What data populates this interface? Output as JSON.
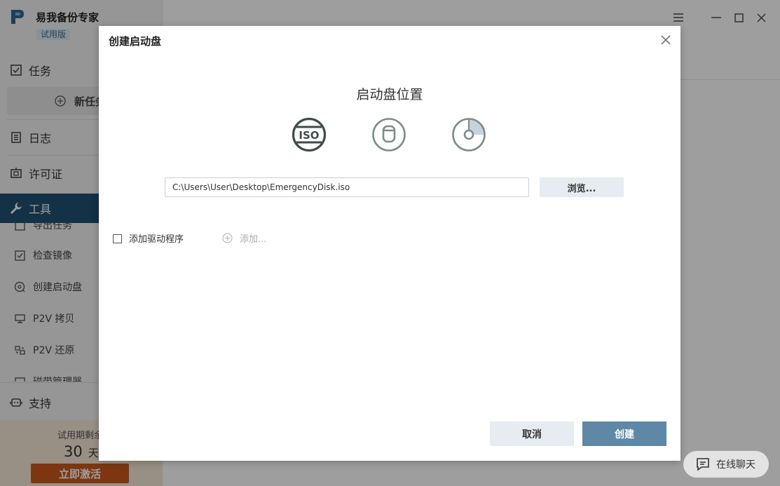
{
  "app": {
    "name": "易我备份专家",
    "badge": "试用版"
  },
  "sidebar": {
    "items": [
      {
        "label": "任务",
        "icon": "task-check-icon"
      },
      {
        "label": "日志",
        "icon": "log-icon"
      },
      {
        "label": "许可证",
        "icon": "license-icon"
      },
      {
        "label": "工具",
        "icon": "wrench-icon"
      },
      {
        "label": "支持",
        "icon": "support-icon"
      }
    ],
    "new_task_label": "新任务",
    "tools_sub": [
      {
        "label": "导出任务",
        "icon": "export-icon"
      },
      {
        "label": "检查镜像",
        "icon": "check-image-icon"
      },
      {
        "label": "创建启动盘",
        "icon": "boot-disk-icon"
      },
      {
        "label": "P2V 拷贝",
        "icon": "p2v-copy-icon"
      },
      {
        "label": "P2V 还原",
        "icon": "p2v-restore-icon"
      },
      {
        "label": "磁带管理器",
        "icon": "tape-manager-icon"
      }
    ],
    "trial": {
      "text": "试用期剩余",
      "days": "30",
      "unit": "天",
      "activate_label": "立即激活"
    }
  },
  "chat": {
    "label": "在线聊天"
  },
  "dialog": {
    "title": "创建启动盘",
    "section_title": "启动盘位置",
    "targets": [
      {
        "name": "ISO",
        "icon": "iso-icon",
        "selected": true
      },
      {
        "name": "USB",
        "icon": "usb-icon",
        "selected": false
      },
      {
        "name": "CD/DVD",
        "icon": "cd-dvd-icon",
        "selected": false
      }
    ],
    "iso_text": "ISO",
    "path_value": "C:\\Users\\User\\Desktop\\EmergencyDisk.iso",
    "browse_label": "浏览...",
    "add_driver_label": "添加驱动程序",
    "add_driver_checked": false,
    "add_label": "添加...",
    "cancel_label": "取消",
    "create_label": "创建"
  },
  "colors": {
    "sidebar_active": "#1f4f73",
    "activate": "#c85a1e",
    "primary_button": "#5e88a6",
    "secondary_button": "#e6ecf1"
  }
}
